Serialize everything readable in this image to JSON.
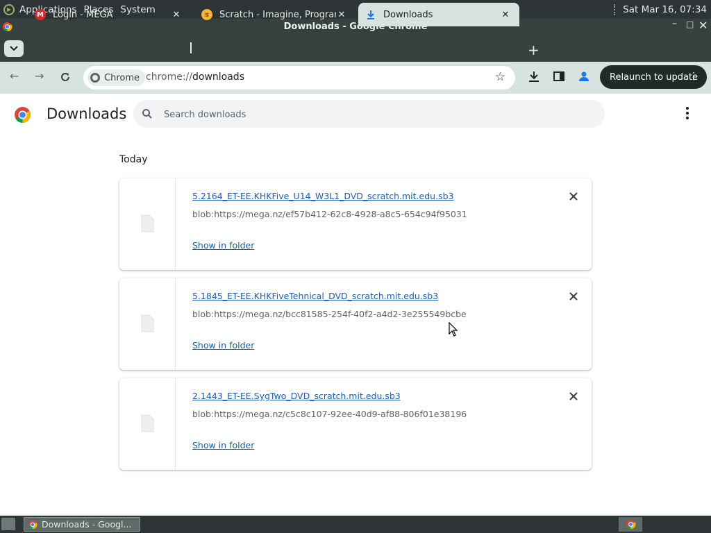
{
  "topbar": {
    "applications": "Applications",
    "places": "Places",
    "system": "System",
    "clock": "Sat Mar 16, 07:34"
  },
  "window": {
    "title": "Downloads - Google Chrome"
  },
  "tabs": [
    {
      "label": "Login - MEGA",
      "favicon": "mega-icon"
    },
    {
      "label": "Scratch - Imagine, Program,",
      "favicon": "scratch-icon"
    },
    {
      "label": "Downloads",
      "favicon": "download-icon",
      "active": true
    }
  ],
  "toolbar": {
    "chip_label": "Chrome",
    "url_scheme": "chrome://",
    "url_path": "downloads",
    "relaunch_label": "Relaunch to update"
  },
  "page": {
    "title": "Downloads",
    "search_placeholder": "Search downloads",
    "section": "Today"
  },
  "downloads": [
    {
      "name": "5.2164_ET-EE.KHKFive_U14_W3L1_DVD_scratch.mit.edu.sb3",
      "url": "blob:https://mega.nz/ef57b412-62c8-4928-a8c5-654c94f95031",
      "action": "Show in folder"
    },
    {
      "name": "5.1845_ET-EE.KHKFiveTehnical_DVD_scratch.mit.edu.sb3",
      "url": "blob:https://mega.nz/bcc81585-254f-40f2-a4d2-3e255549bcbe",
      "action": "Show in folder"
    },
    {
      "name": "2.1443_ET-EE.SygTwo_DVD_scratch.mit.edu.sb3",
      "url": "blob:https://mega.nz/c5c8c107-92ee-40d9-af88-806f01e38196",
      "action": "Show in folder"
    }
  ],
  "taskbar": {
    "item_label": "Downloads - Googl..."
  },
  "colors": {
    "accent": "#1a5fb4",
    "frame": "#34413f",
    "toolbar": "#d6e3df",
    "panel": "#2e3436"
  }
}
